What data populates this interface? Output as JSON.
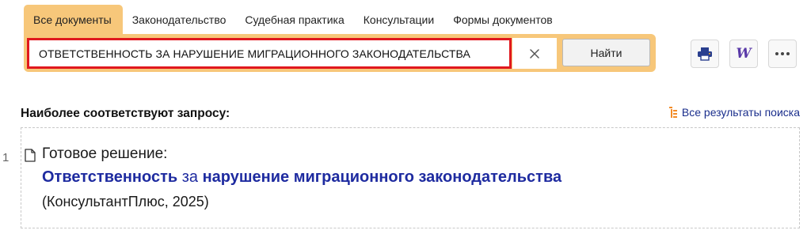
{
  "tabs": [
    {
      "label": "Все документы",
      "active": true
    },
    {
      "label": "Законодательство",
      "active": false
    },
    {
      "label": "Судебная практика",
      "active": false
    },
    {
      "label": "Консультации",
      "active": false
    },
    {
      "label": "Формы документов",
      "active": false
    }
  ],
  "search": {
    "value": "ОТВЕТСТВЕННОСТЬ ЗА НАРУШЕНИЕ МИГРАЦИОННОГО ЗАКОНОДАТЕЛЬСТВА",
    "clear_icon": "×",
    "find_label": "Найти"
  },
  "toolbar": {
    "icons": [
      "printer-icon",
      "word-icon",
      "more-icon"
    ],
    "word_glyph": "W"
  },
  "results": {
    "heading": "Наиболее соответствуют запросу:",
    "all_results_label": "Все результаты поиска",
    "items": [
      {
        "number": "1",
        "type": "Готовое решение:",
        "title_parts": [
          {
            "text": "Ответственность",
            "highlight": true
          },
          {
            "text": " за ",
            "highlight": false
          },
          {
            "text": "нарушение миграционного законодательства",
            "highlight": true
          }
        ],
        "source": "(КонсультантПлюс, 2025)"
      }
    ]
  },
  "colors": {
    "tab_active": "#f7c77a",
    "search_border": "#e0181e",
    "link": "#1e2ba0"
  }
}
